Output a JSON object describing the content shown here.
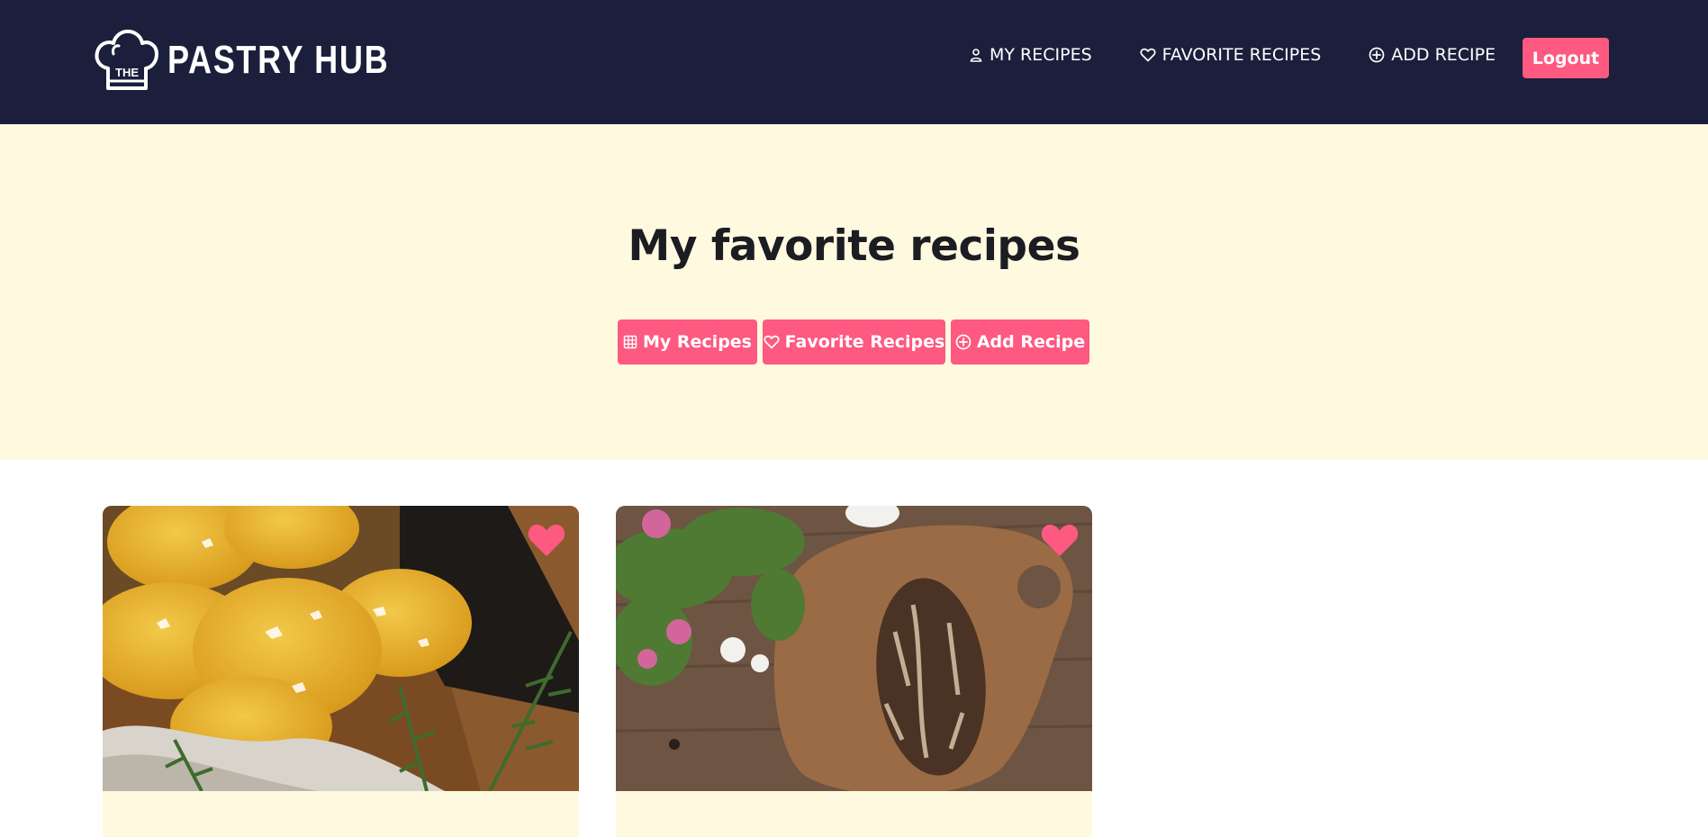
{
  "brand": {
    "logo_small": "THE",
    "name": "PASTRY HUB"
  },
  "nav": {
    "items": [
      {
        "label": "MY RECIPES",
        "icon": "user-icon"
      },
      {
        "label": "FAVORITE RECIPES",
        "icon": "heart-outline-icon"
      },
      {
        "label": "ADD RECIPE",
        "icon": "plus-circle-icon"
      }
    ],
    "logout_label": "Logout"
  },
  "hero": {
    "title": "My favorite recipes",
    "buttons": [
      {
        "label": "My Recipes",
        "icon": "grid-icon"
      },
      {
        "label": "Favorite Recipes",
        "icon": "heart-outline-icon"
      },
      {
        "label": "Add Recipe",
        "icon": "plus-circle-icon"
      }
    ]
  },
  "cards": [
    {
      "image": "lemon crinkle cookies on a wooden table",
      "favorited": true
    },
    {
      "image": "sourdough bread loaf on a wooden cutting board",
      "favorited": true
    }
  ],
  "colors": {
    "navbar": "#1b1f3c",
    "accent": "#fd5981",
    "hero_bg": "#fff9e0",
    "title": "#1c1d22"
  }
}
